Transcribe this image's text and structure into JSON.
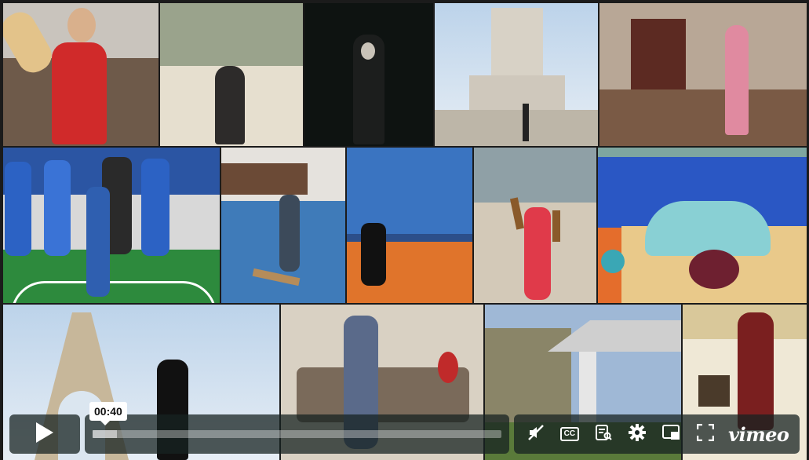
{
  "player": {
    "current_time": "00:40",
    "progress_percent": 6,
    "brand": "vimeo"
  },
  "icons": [
    "play-icon",
    "volume-muted-icon",
    "cc-icon",
    "transcript-icon",
    "settings-gear-icon",
    "picture-in-picture-icon",
    "fullscreen-icon"
  ],
  "controls": {
    "cc_label": "CC"
  },
  "colors": {
    "controls_bg": "#172322",
    "progress_fill": "#ffffff"
  }
}
